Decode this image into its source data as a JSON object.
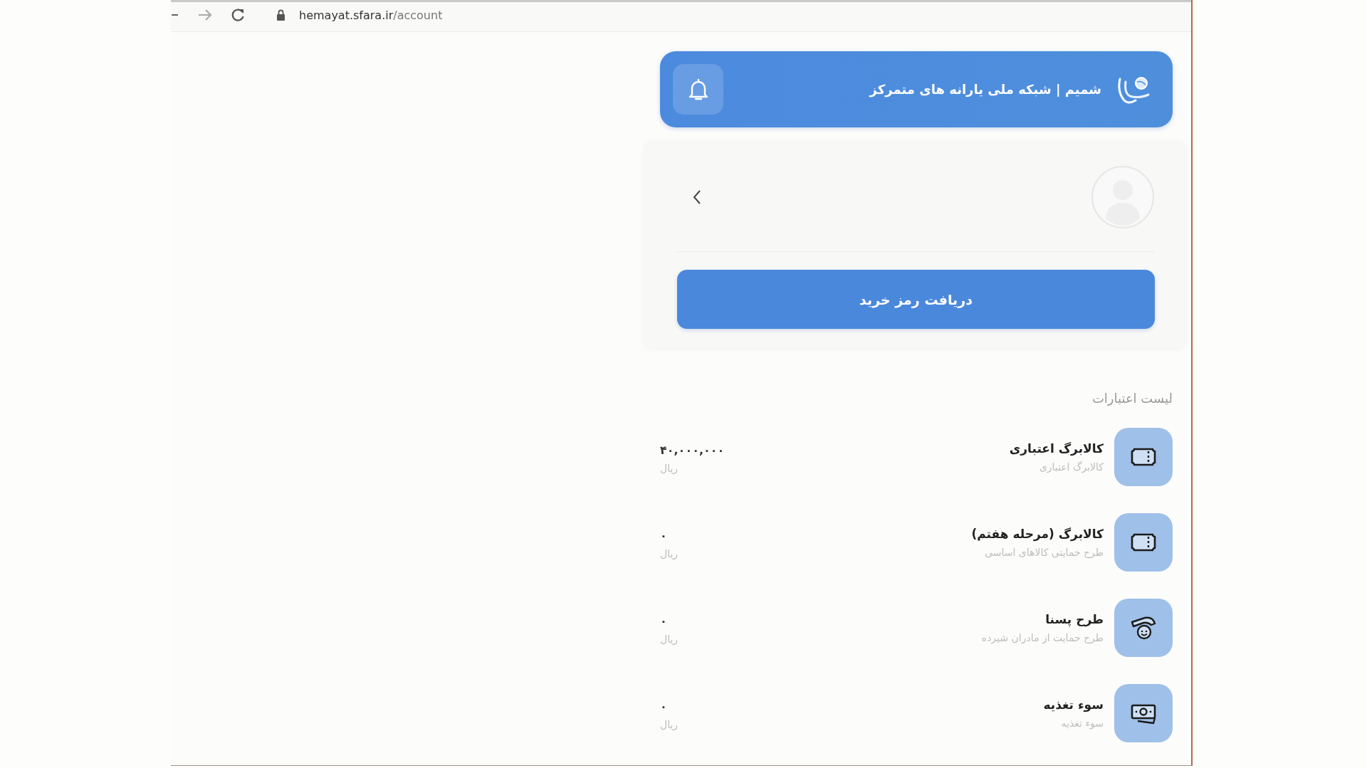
{
  "browser": {
    "url_host": "hemayat.sfara.ir",
    "url_path": "/account"
  },
  "header": {
    "title": "شمیم | شبکه ملی یارانه های متمرکز"
  },
  "profile": {
    "button": "دریافت رمز خرید"
  },
  "credits": {
    "title": "لیست اعتبارات",
    "items": [
      {
        "kind": "ticket",
        "title": "کالابرگ اعتباری",
        "subtitle": "کالابرگ اعتباری",
        "amount": "۴۰,۰۰۰,۰۰۰",
        "currency": "ریال"
      },
      {
        "kind": "ticket",
        "title": "کالابرگ (مرحله هفتم)",
        "subtitle": "طرح حمایتی کالاهای اساسی",
        "amount": "۰",
        "currency": "ریال"
      },
      {
        "kind": "mother",
        "title": "طرح پسنا",
        "subtitle": "طرح حمایت از مادران شیرده",
        "amount": "۰",
        "currency": "ریال"
      },
      {
        "kind": "cash",
        "title": "سوء تغذیه",
        "subtitle": "سوء تغذیه",
        "amount": "۰",
        "currency": "ریال"
      }
    ]
  }
}
